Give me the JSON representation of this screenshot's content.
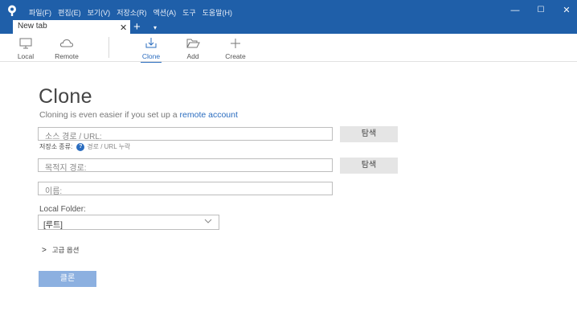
{
  "window": {
    "menu": [
      "파일(F)",
      "편집(E)",
      "보기(V)",
      "저장소(R)",
      "액션(A)",
      "도구",
      "도움말(H)"
    ],
    "controls": {
      "minimize": "—",
      "maximize": "☐",
      "close": "✕"
    }
  },
  "tabs": {
    "active_label": "New tab",
    "close_glyph": "✕",
    "add_glyph": "+",
    "dropdown_glyph": "▾"
  },
  "toolbar": {
    "local": "Local",
    "remote": "Remote",
    "clone": "Clone",
    "add": "Add",
    "create": "Create",
    "active": "clone"
  },
  "form": {
    "title": "Clone",
    "subtitle_text": "Cloning is even easier if you set up a ",
    "subtitle_link": "remote account",
    "source_placeholder": "소스 경로 / URL:",
    "browse_label": "탐색",
    "repo_type_label": "저장소 종류:",
    "repo_type_help": "?",
    "repo_type_value": "경로 / URL 누락",
    "dest_placeholder": "목적지 경로:",
    "name_placeholder": "이름:",
    "local_folder_label": "Local Folder:",
    "local_folder_value": "[루트]",
    "advanced_label": "고급 옵션",
    "advanced_arrow": ">",
    "clone_button": "클론"
  },
  "colors": {
    "titlebar": "#1f5fa9",
    "accent": "#2a6cbf",
    "clone_button": "#8cb0e0"
  }
}
